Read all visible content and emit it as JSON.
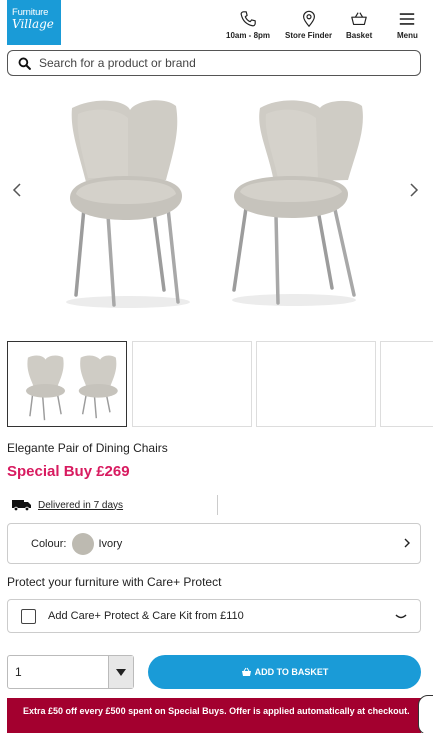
{
  "header": {
    "logo_line1": "Furniture",
    "logo_line2": "Village",
    "hours_label": "10am - 8pm",
    "store_label": "Store Finder",
    "basket_label": "Basket",
    "menu_label": "Menu",
    "icons": [
      "phone-icon",
      "location-pin-icon",
      "basket-icon",
      "hamburger-icon"
    ]
  },
  "search": {
    "placeholder": "Search for a product or brand",
    "icon": "search-icon"
  },
  "gallery": {
    "image": "two light grey upholstered dining chairs with metal legs",
    "thumbnail_count_visible": 4,
    "active_thumbnail": 1
  },
  "product": {
    "title": "Elegante Pair of Dining Chairs",
    "price": "Special Buy £269",
    "delivery": "Delivered in 7 days",
    "colour_label": "Colour:",
    "colour_value": "Ivory",
    "colour_swatch": "#bdbab1"
  },
  "care": {
    "heading": "Protect your furniture with Care+ Protect",
    "option_label": "Add Care+ Protect & Care Kit from £110"
  },
  "purchase": {
    "quantity": "1",
    "add_button": "ADD TO BASKET"
  },
  "promo": {
    "text": "Extra £50 off every £500 spent on Special Buys. Offer is applied automatically at checkout."
  },
  "colors": {
    "brand_blue": "#1a9bd7",
    "price_pink": "#d81b60",
    "promo_red": "#a3002f"
  }
}
